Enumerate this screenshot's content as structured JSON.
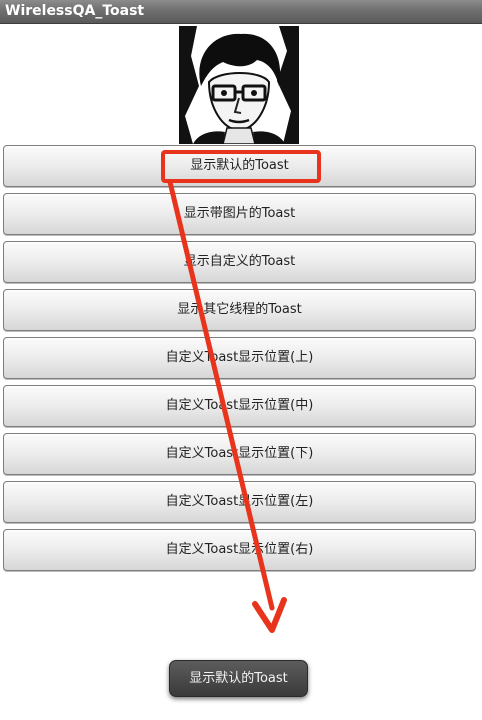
{
  "app": {
    "title": "WirelessQA_Toast"
  },
  "photo": {
    "description_icon": "user-photo"
  },
  "buttons": [
    {
      "label": "显示默认的Toast"
    },
    {
      "label": "显示带图片的Toast"
    },
    {
      "label": "显示自定义的Toast"
    },
    {
      "label": "显示其它线程的Toast"
    },
    {
      "label": "自定义Toast显示位置(上)"
    },
    {
      "label": "自定义Toast显示位置(中)"
    },
    {
      "label": "自定义Toast显示位置(下)"
    },
    {
      "label": "自定义Toast显示位置(左)"
    },
    {
      "label": "自定义Toast显示位置(右)"
    }
  ],
  "toast": {
    "text": "显示默认的Toast"
  },
  "colors": {
    "annotation": "#e8341c",
    "titlebar": "#6f6f6f",
    "toast_bg": "#3a3a3a"
  }
}
